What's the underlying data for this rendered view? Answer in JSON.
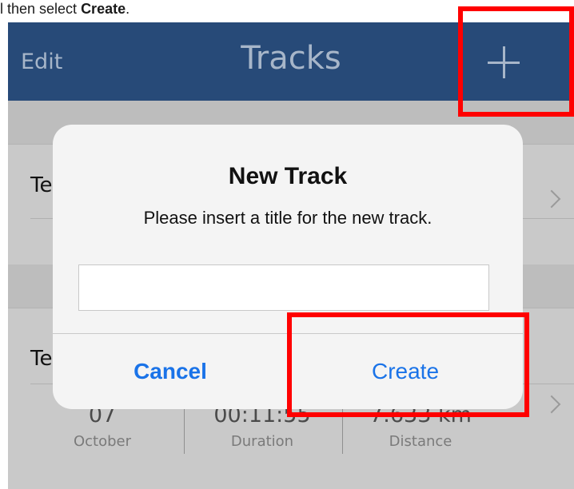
{
  "instruction": {
    "prefix": "l then select ",
    "emphasis": "Create",
    "suffix": "."
  },
  "navbar": {
    "edit_label": "Edit",
    "title": "Tracks",
    "add_icon": "plus-icon"
  },
  "tracks": [
    {
      "title_partial": "Te"
    },
    {
      "title_partial": "Te",
      "day": "07",
      "month": "October",
      "duration_value": "00:11:55",
      "duration_label": "Duration",
      "distance_value": "7.633 km",
      "distance_label": "Distance"
    }
  ],
  "dialog": {
    "title": "New Track",
    "message": "Please insert a title for the new track.",
    "input_value": "",
    "cancel_label": "Cancel",
    "create_label": "Create"
  },
  "colors": {
    "navbar": "#274a78",
    "nav_text": "#a7b6c9",
    "accent": "#1a73e8",
    "highlight": "#ff0000"
  }
}
